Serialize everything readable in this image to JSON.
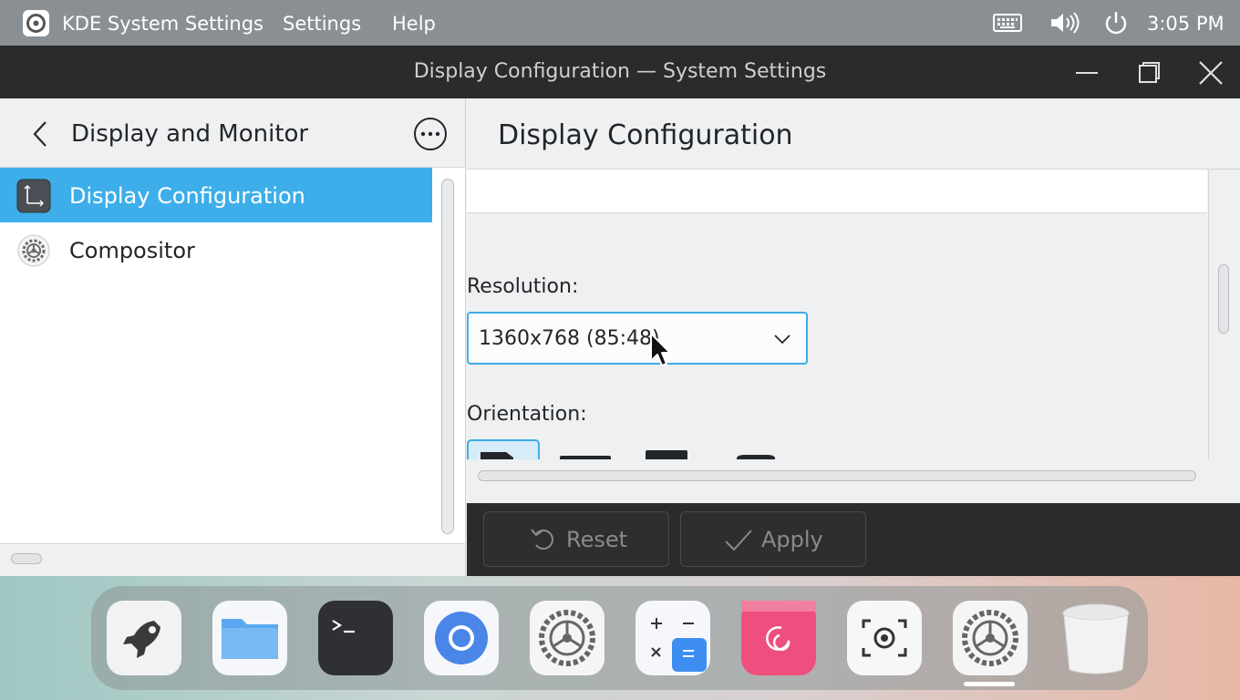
{
  "topbar": {
    "app_name": "KDE System Settings",
    "menu_settings": "Settings",
    "menu_help": "Help",
    "clock": "3:05 PM"
  },
  "window": {
    "title": "Display Configuration — System Settings"
  },
  "sidebar": {
    "heading": "Display and Monitor",
    "items": [
      {
        "label": "Display Configuration",
        "icon": "display-config-icon",
        "selected": true
      },
      {
        "label": "Compositor",
        "icon": "gear-icon",
        "selected": false
      }
    ]
  },
  "main": {
    "title": "Display Configuration",
    "resolution_label": "Resolution:",
    "resolution_value": "1360x768 (85:48)",
    "orientation_label": "Orientation:"
  },
  "footer": {
    "reset_label": "Reset",
    "apply_label": "Apply"
  },
  "dock": {
    "items": [
      "launcher-rocket-icon",
      "files-folder-icon",
      "terminal-icon",
      "chromium-icon",
      "settings-gear-icon",
      "calculator-icon",
      "debian-icon",
      "screenshot-icon",
      "system-settings-icon",
      "trash-icon"
    ],
    "active": "system-settings-icon"
  },
  "colors": {
    "accent": "#3daee9",
    "titlebar": "#2b2b2b",
    "topbar": "#8a8f94"
  }
}
